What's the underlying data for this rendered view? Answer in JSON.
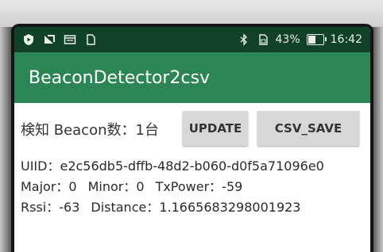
{
  "status_bar": {
    "battery_percent": "43%",
    "time": "16:42",
    "icons": [
      "shield-icon",
      "signal-icon",
      "notification-icon",
      "sim-icon",
      "bluetooth-icon",
      "sim-card-icon",
      "battery-icon"
    ]
  },
  "app_bar": {
    "title": "BeaconDetector2csv"
  },
  "main": {
    "count_label": "検知 Beacon数：1台",
    "update_button": "UPDATE",
    "csv_save_button": "CSV_SAVE",
    "uuid": "UIID：e2c56db5-dffb-48d2-b060-d0f5a71096e0",
    "major": "Major：0",
    "minor": "Minor：0",
    "txpower": "TxPower：-59",
    "rssi": "Rssi：-63",
    "distance": "Distance：1.1665683298001923"
  },
  "colors": {
    "status_bar": "#12412a",
    "app_bar": "#2b8555",
    "button": "#d7d7d7"
  }
}
